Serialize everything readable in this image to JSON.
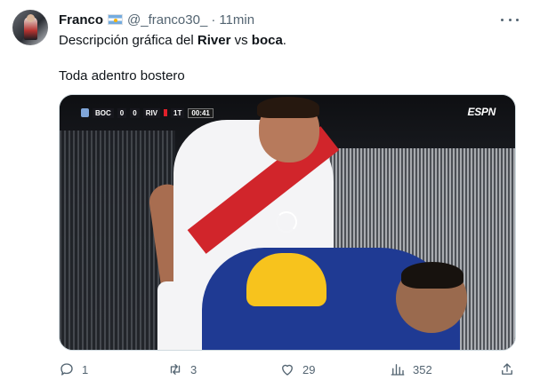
{
  "author": {
    "name": "Franco",
    "flag_emoji": "argentina-flag",
    "handle": "@_franco30_",
    "separator": "·",
    "time": "11min"
  },
  "tweet": {
    "line1_prefix": "Descripción gráfica del ",
    "line1_bold1": "River",
    "line1_mid": " vs ",
    "line1_bold2": "boca",
    "line1_suffix": ".",
    "line2": "Toda adentro bostero"
  },
  "media": {
    "scorebug": {
      "home": "BOC",
      "home_score": "0",
      "away_score": "0",
      "away": "RIV",
      "period": "1T",
      "clock": "00:41"
    },
    "broadcaster": "ESPN",
    "colors": {
      "river_red": "#d1252b",
      "boca_blue": "#1f3a93",
      "boca_gold": "#f7c31d"
    }
  },
  "actions": {
    "reply_count": "1",
    "retweet_count": "3",
    "like_count": "29",
    "views_count": "352"
  },
  "icons": [
    "more-icon",
    "reply-icon",
    "retweet-icon",
    "like-icon",
    "views-icon",
    "share-icon",
    "loading-spinner-icon"
  ]
}
